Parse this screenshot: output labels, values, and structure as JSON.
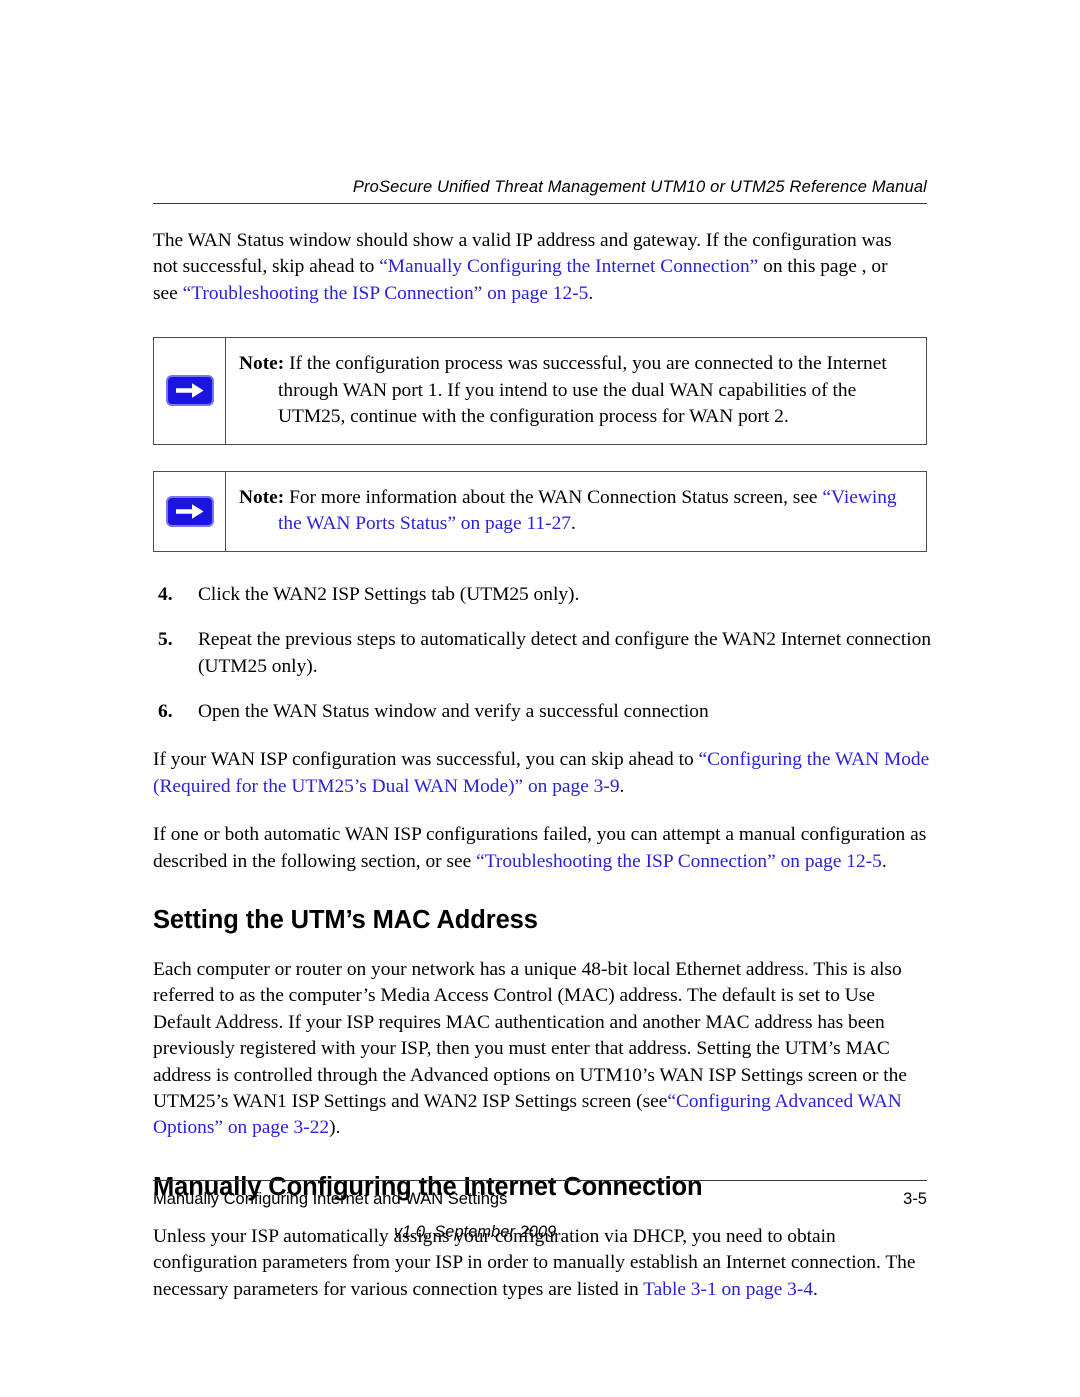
{
  "colors": {
    "xref_blue": "#2b22d8",
    "icon_blue": "#1a14e0",
    "icon_border": "#7a74f0",
    "rule_gray": "#3a3a3a",
    "text": "#000000"
  },
  "header": {
    "running_title": "ProSecure Unified Threat Management UTM10 or UTM25 Reference Manual"
  },
  "intro_paragraph": {
    "seg1": "The WAN Status window should show a valid IP address and gateway. If the configuration was not successful, skip ahead to ",
    "link1": "“Manually Configuring the Internet Connection”",
    "seg2": " on this page , or see ",
    "link2": "“Troubleshooting the ISP Connection” on page 12-5",
    "seg3": "."
  },
  "notes": [
    {
      "icon": "right-arrow-icon",
      "label": "Note:",
      "text": " If the configuration process was successful, you are connected to the Internet through WAN port 1. If you intend to use the dual WAN capabilities of the UTM25, continue with the configuration process for WAN port 2."
    },
    {
      "icon": "right-arrow-icon",
      "label": "Note:",
      "text_before": " For more information about the WAN Connection Status screen, see ",
      "link": "“Viewing the WAN Ports Status” on page 11-27",
      "text_after": "."
    }
  ],
  "steps": [
    {
      "number": "4.",
      "text": "Click the WAN2 ISP Settings tab (UTM25 only)."
    },
    {
      "number": "5.",
      "text": "Repeat the previous steps to automatically detect and configure the WAN2 Internet connection (UTM25 only)."
    },
    {
      "number": "6.",
      "text": "Open the WAN Status window and verify a successful connection"
    }
  ],
  "para_success": {
    "seg1": "If your WAN ISP configuration was successful, you can skip ahead to ",
    "link": "“Configuring the WAN Mode (Required for the UTM25’s Dual WAN Mode)” on page 3-9",
    "seg2": "."
  },
  "para_failed": {
    "seg1": "If one or both automatic WAN ISP configurations failed, you can attempt a manual configuration as described in the following section, or see ",
    "link": "“Troubleshooting the ISP Connection” on page 12-5",
    "seg2": "."
  },
  "section_mac": {
    "heading": "Setting the UTM’s MAC Address",
    "body_seg1": "Each computer or router on your network has a unique 48-bit local Ethernet address. This is also referred to as the computer’s Media Access Control (MAC) address. The default is set to Use Default Address. If your ISP requires MAC authentication and another MAC address has been previously registered with your ISP, then you must enter that address. Setting the UTM’s MAC address is controlled through the Advanced options on UTM10’s WAN ISP Settings screen or the UTM25’s WAN1 ISP Settings and WAN2 ISP Settings screen (see",
    "body_link": "“Configuring Advanced WAN Options” on page 3-22",
    "body_seg2": ")."
  },
  "section_manual": {
    "heading": "Manually Configuring the Internet Connection",
    "body_seg1": "Unless your ISP automatically assigns your configuration via DHCP, you need to obtain configuration parameters from your ISP in order to manually establish an Internet connection. The necessary parameters for various connection types are listed in ",
    "body_link": "Table 3-1 on page 3-4",
    "body_seg2": "."
  },
  "footer": {
    "chapter_title": "Manually Configuring Internet and WAN Settings",
    "page_number": "3-5",
    "version": "v1.0, September 2009"
  }
}
